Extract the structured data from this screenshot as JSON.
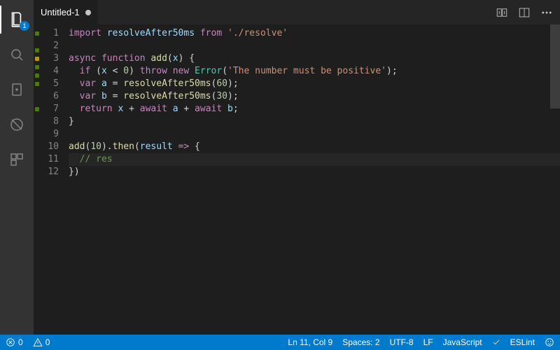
{
  "activity": {
    "explorer_badge": "1"
  },
  "tabs": {
    "title": "Untitled-1"
  },
  "gutter_markers": {
    "1": "green",
    "2": null,
    "3": "green",
    "4": "yellow",
    "5": "green",
    "6": "green",
    "7": "green",
    "8": null,
    "9": null,
    "10": "green",
    "11": null,
    "12": null
  },
  "code": [
    [
      [
        "kw",
        "import"
      ],
      [
        "pl",
        " "
      ],
      [
        "id",
        "resolveAfter50ms"
      ],
      [
        "pl",
        " "
      ],
      [
        "kw",
        "from"
      ],
      [
        "pl",
        " "
      ],
      [
        "str",
        "'./resolve'"
      ]
    ],
    [],
    [
      [
        "kw",
        "async"
      ],
      [
        "pl",
        " "
      ],
      [
        "kw",
        "function"
      ],
      [
        "pl",
        " "
      ],
      [
        "fn",
        "add"
      ],
      [
        "pl",
        "("
      ],
      [
        "id",
        "x"
      ],
      [
        "pl",
        ") {"
      ]
    ],
    [
      [
        "pl",
        "  "
      ],
      [
        "kw",
        "if"
      ],
      [
        "pl",
        " ("
      ],
      [
        "id",
        "x"
      ],
      [
        "pl",
        " < "
      ],
      [
        "num",
        "0"
      ],
      [
        "pl",
        ") "
      ],
      [
        "kw",
        "throw"
      ],
      [
        "pl",
        " "
      ],
      [
        "kw",
        "new"
      ],
      [
        "pl",
        " "
      ],
      [
        "cls",
        "Error"
      ],
      [
        "pl",
        "("
      ],
      [
        "str",
        "'The number must be positive'"
      ],
      [
        "pl",
        ");"
      ]
    ],
    [
      [
        "pl",
        "  "
      ],
      [
        "kw",
        "var"
      ],
      [
        "pl",
        " "
      ],
      [
        "id",
        "a"
      ],
      [
        "pl",
        " = "
      ],
      [
        "fn",
        "resolveAfter50ms"
      ],
      [
        "pl",
        "("
      ],
      [
        "num",
        "60"
      ],
      [
        "pl",
        ");"
      ]
    ],
    [
      [
        "pl",
        "  "
      ],
      [
        "kw",
        "var"
      ],
      [
        "pl",
        " "
      ],
      [
        "id",
        "b"
      ],
      [
        "pl",
        " = "
      ],
      [
        "fn",
        "resolveAfter50ms"
      ],
      [
        "pl",
        "("
      ],
      [
        "num",
        "30"
      ],
      [
        "pl",
        ");"
      ]
    ],
    [
      [
        "pl",
        "  "
      ],
      [
        "kw",
        "return"
      ],
      [
        "pl",
        " "
      ],
      [
        "id",
        "x"
      ],
      [
        "pl",
        " + "
      ],
      [
        "kw",
        "await"
      ],
      [
        "pl",
        " "
      ],
      [
        "id",
        "a"
      ],
      [
        "pl",
        " + "
      ],
      [
        "kw",
        "await"
      ],
      [
        "pl",
        " "
      ],
      [
        "id",
        "b"
      ],
      [
        "pl",
        ";"
      ]
    ],
    [
      [
        "pl",
        "}"
      ]
    ],
    [],
    [
      [
        "fn",
        "add"
      ],
      [
        "pl",
        "("
      ],
      [
        "num",
        "10"
      ],
      [
        "pl",
        ")."
      ],
      [
        "fn",
        "then"
      ],
      [
        "pl",
        "("
      ],
      [
        "id",
        "result"
      ],
      [
        "pl",
        " "
      ],
      [
        "kw",
        "=>"
      ],
      [
        "pl",
        " {"
      ]
    ],
    [
      [
        "pl",
        "  "
      ],
      [
        "cmt",
        "// res"
      ]
    ],
    [
      [
        "pl",
        "})"
      ]
    ]
  ],
  "current_line_index": 10,
  "status": {
    "errors": "0",
    "warnings": "0",
    "ln_col": "Ln 11, Col 9",
    "spaces": "Spaces: 2",
    "encoding": "UTF-8",
    "eol": "LF",
    "language": "JavaScript",
    "eslint": "ESLint"
  }
}
